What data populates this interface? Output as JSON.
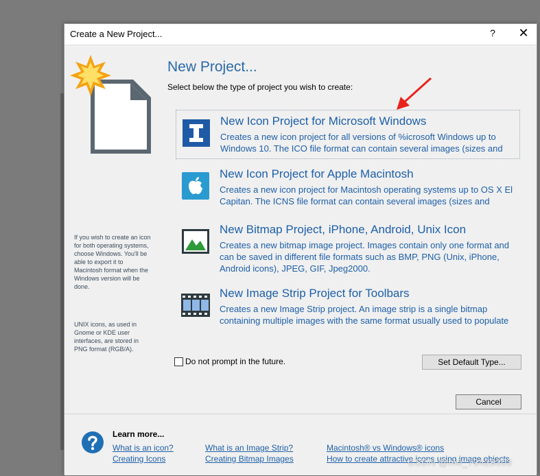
{
  "window": {
    "title": "Create a New Project...",
    "help_glyph": "?",
    "close_glyph": "✕"
  },
  "header": {
    "heading": "New Project...",
    "subtitle": "Select below the type of project you wish to create:"
  },
  "sidebar": {
    "note1": "If you wish to create an icon for both operating systems, choose Windows. You'll be able to export it to Macintosh format when the Windows version will be done.",
    "note2": "UNIX icons, as used in Gnome or KDE user interfaces, are stored in PNG format (RGB/A)."
  },
  "options": [
    {
      "title": "New Icon Project for Microsoft Windows",
      "description": "Creates a new icon project for all versions of %icrosoft Windows up to Windows 10. The ICO file format can contain several images (sizes and",
      "icon": "windows-icon-letter-i",
      "selected": true
    },
    {
      "title": "New Icon Project for Apple Macintosh",
      "description": "Creates a new icon project for Macintosh operating systems up to OS X El Capitan. The ICNS file format can contain several images (sizes and",
      "icon": "apple-icon",
      "selected": false
    },
    {
      "title": "New Bitmap Project, iPhone, Android, Unix Icon",
      "description": "Creates a new bitmap image project. Images contain only one format and can be saved in different file formats such as BMP, PNG (Unix, iPhone, Android icons), JPEG, GIF, Jpeg2000.",
      "icon": "landscape-image-icon",
      "selected": false
    },
    {
      "title": "New Image Strip Project for Toolbars",
      "description": "Creates a new Image Strip project.  An image strip is a single bitmap containing multiple images with the same format usually used to populate",
      "icon": "film-strip-icon",
      "selected": false
    }
  ],
  "controls": {
    "dont_prompt_label": "Do not prompt in the future.",
    "dont_prompt_checked": false,
    "set_default_label": "Set Default Type...",
    "cancel_label": "Cancel"
  },
  "footer": {
    "learn_more": "Learn more...",
    "links": [
      "What is an icon?",
      "Creating Icons",
      "What is an Image Strip?",
      "Creating Bitmap Images",
      "Macintosh® vs Windows® icons",
      "How to create attractive icons using image objects"
    ]
  },
  "watermark": "CSDN @m0_73428303",
  "colors": {
    "accent_blue": "#1d5fa8",
    "heading_blue": "#2a6aa6",
    "annotation_red": "#e8231c",
    "dialog_bg": "#f0f0f0"
  }
}
